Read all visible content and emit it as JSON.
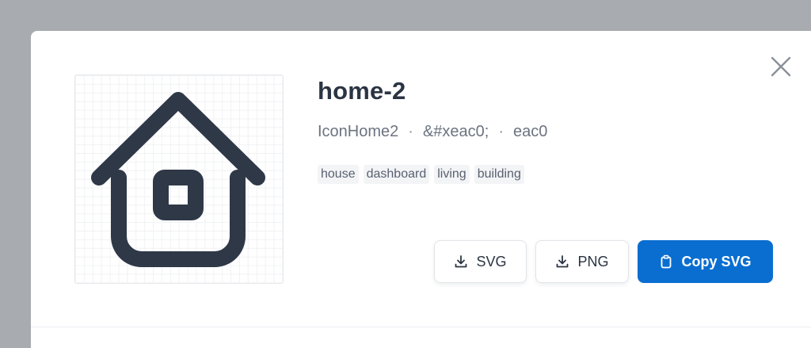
{
  "modal": {
    "close_icon": "x-icon"
  },
  "icon": {
    "name": "home-2",
    "component": "IconHome2",
    "entity": "&#xeac0;",
    "code": "eac0",
    "separator": "·",
    "tags": [
      "house",
      "dashboard",
      "living",
      "building"
    ],
    "stroke_color": "#2f3847"
  },
  "actions": {
    "svg_label": "SVG",
    "png_label": "PNG",
    "copy_label": "Copy SVG",
    "download_icon": "download-icon",
    "clipboard_icon": "clipboard-icon",
    "primary_color": "#0a6ed1"
  }
}
